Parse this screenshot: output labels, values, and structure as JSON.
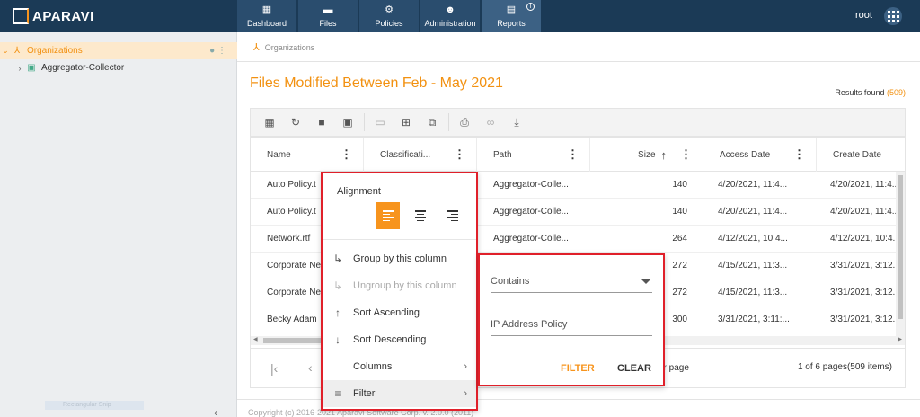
{
  "app": {
    "brand": "APARAVI",
    "user": "root"
  },
  "nav": [
    {
      "label": "Dashboard",
      "icon": "dashboard-icon"
    },
    {
      "label": "Files",
      "icon": "folder-icon"
    },
    {
      "label": "Policies",
      "icon": "gear-icon"
    },
    {
      "label": "Administration",
      "icon": "users-icon"
    },
    {
      "label": "Reports",
      "icon": "clipboard-icon",
      "active": true
    }
  ],
  "sidebar": {
    "items": [
      {
        "label": "Organizations",
        "selected": true
      },
      {
        "label": "Aggregator-Collector"
      }
    ],
    "footer_label": "Rectangular Snip"
  },
  "breadcrumb": "Organizations",
  "report": {
    "title": "Files Modified Between Feb - May 2021",
    "results_label": "Results found",
    "results_count": "(509)"
  },
  "grid": {
    "columns": [
      "Name",
      "Classificati...",
      "Path",
      "Size",
      "Access Date",
      "Create Date"
    ],
    "rows": [
      {
        "name": "Auto Policy.t",
        "path": "Aggregator-Colle...",
        "size": "140",
        "access": "4/20/2021, 11:4...",
        "create": "4/20/2021, 11:4..."
      },
      {
        "name": "Auto Policy.t",
        "path": "Aggregator-Colle...",
        "size": "140",
        "access": "4/20/2021, 11:4...",
        "create": "4/20/2021, 11:4..."
      },
      {
        "name": "Network.rtf",
        "path": "Aggregator-Colle...",
        "size": "264",
        "access": "4/12/2021, 10:4...",
        "create": "4/12/2021, 10:4..."
      },
      {
        "name": "Corporate Ne",
        "path": "",
        "size": "272",
        "access": "4/15/2021, 11:3...",
        "create": "3/31/2021, 3:12..."
      },
      {
        "name": "Corporate Ne",
        "path": "",
        "size": "272",
        "access": "4/15/2021, 11:3...",
        "create": "3/31/2021, 3:12..."
      },
      {
        "name": "Becky Adam",
        "path": "",
        "size": "300",
        "access": "3/31/2021, 3:11:...",
        "create": "3/31/2021, 3:12..."
      }
    ]
  },
  "pager": {
    "per_page": "er page",
    "info": "1 of 6 pages(509 items)"
  },
  "column_menu": {
    "alignment_label": "Alignment",
    "items": [
      {
        "label": "Group by this column",
        "icon": "group-icon"
      },
      {
        "label": "Ungroup by this column",
        "icon": "ungroup-icon",
        "disabled": true
      },
      {
        "label": "Sort Ascending",
        "icon": "arrow-up-icon"
      },
      {
        "label": "Sort Descending",
        "icon": "arrow-down-icon"
      },
      {
        "label": "Columns",
        "submenu": true
      },
      {
        "label": "Filter",
        "icon": "filter-icon",
        "submenu": true
      }
    ]
  },
  "filter_panel": {
    "operator": "Contains",
    "value": "IP Address Policy",
    "filter_label": "FILTER",
    "clear_label": "CLEAR"
  },
  "footer": "Copyright (c) 2016-2021 Aparavi Software Corp. v. 2.0.0 (2011)",
  "colors": {
    "accent": "#f7941d",
    "topbar": "#1b3a56",
    "highlight": "#e0202a"
  }
}
